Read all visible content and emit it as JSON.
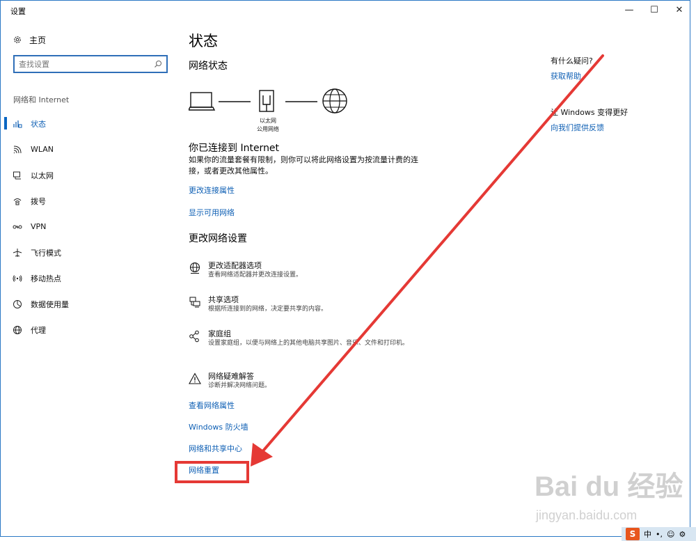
{
  "window": {
    "title": "设置",
    "minimize": "—",
    "maximize": "☐",
    "close": "✕"
  },
  "sidebar": {
    "home_label": "主页",
    "search_placeholder": "查找设置",
    "section_label": "网络和 Internet",
    "items": [
      {
        "label": "状态",
        "icon": "status-icon",
        "active": true
      },
      {
        "label": "WLAN",
        "icon": "wlan-icon"
      },
      {
        "label": "以太网",
        "icon": "ethernet-icon"
      },
      {
        "label": "拨号",
        "icon": "dialup-icon"
      },
      {
        "label": "VPN",
        "icon": "vpn-icon"
      },
      {
        "label": "飞行模式",
        "icon": "airplane-icon"
      },
      {
        "label": "移动热点",
        "icon": "hotspot-icon"
      },
      {
        "label": "数据使用量",
        "icon": "data-usage-icon"
      },
      {
        "label": "代理",
        "icon": "proxy-icon"
      }
    ]
  },
  "main": {
    "page_title": "状态",
    "network_status_heading": "网络状态",
    "ethernet_label_1": "以太网",
    "ethernet_label_2": "公用网络",
    "connected_title": "你已连接到 Internet",
    "connected_desc": "如果你的流量套餐有限制，则你可以将此网络设置为按流量计费的连接，或者更改其他属性。",
    "link_change_props": "更改连接属性",
    "link_show_networks": "显示可用网络",
    "change_settings_heading": "更改网络设置",
    "settings": [
      {
        "title": "更改适配器选项",
        "desc": "查看网络适配器并更改连接设置。",
        "icon": "adapter-globe-icon"
      },
      {
        "title": "共享选项",
        "desc": "根据所连接到的网络，决定要共享的内容。",
        "icon": "sharing-icon"
      },
      {
        "title": "家庭组",
        "desc": "设置家庭组，以便与网络上的其他电脑共享图片、音乐、文件和打印机。",
        "icon": "homegroup-icon"
      },
      {
        "title": "网络疑难解答",
        "desc": "诊断并解决网络问题。",
        "icon": "warning-icon"
      }
    ],
    "link_view_props": "查看网络属性",
    "link_firewall": "Windows 防火墙",
    "link_sharing_center": "网络和共享中心",
    "link_reset": "网络重置"
  },
  "right": {
    "question_heading": "有什么疑问?",
    "help_link": "获取帮助",
    "improve_heading": "让 Windows 变得更好",
    "feedback_link": "向我们提供反馈"
  },
  "tray": {
    "ime_logo": "S",
    "ime_lang": "中"
  },
  "watermark": {
    "main": "Bai du 经验",
    "sub": "jingyan.baidu.com"
  },
  "colors": {
    "accent": "#0e5fb4",
    "annotation": "#e53935"
  }
}
